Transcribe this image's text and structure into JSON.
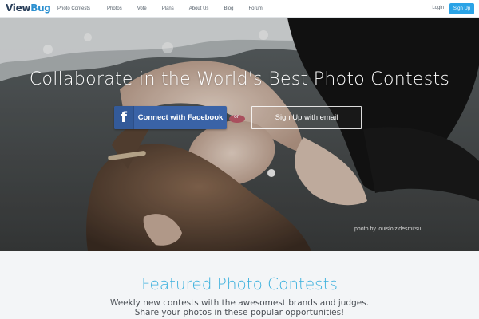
{
  "nav": {
    "logo_view": "View",
    "logo_bug": "Bug",
    "links": [
      "Photo Contests",
      "Photos",
      "Vote",
      "Plans",
      "About Us",
      "Blog",
      "Forum"
    ],
    "login": "Login",
    "signup": "Sign Up"
  },
  "hero": {
    "title": "Collaborate in the World's Best Photo Contests",
    "facebook_icon": "f",
    "facebook_label": "Connect with Facebook",
    "or": "or",
    "email_label": "Sign Up with email",
    "credit": "photo by louisloizidesmitsu"
  },
  "featured": {
    "title": "Featured Photo Contests",
    "subtitle_line1": "Weekly new contests with the awesomest brands and judges.",
    "subtitle_line2": "Share your photos in these popular opportunities!"
  },
  "colors": {
    "brand_blue": "#2aa3e6",
    "facebook_blue": "#3a63a7",
    "featured_title": "#3ab0dd"
  }
}
